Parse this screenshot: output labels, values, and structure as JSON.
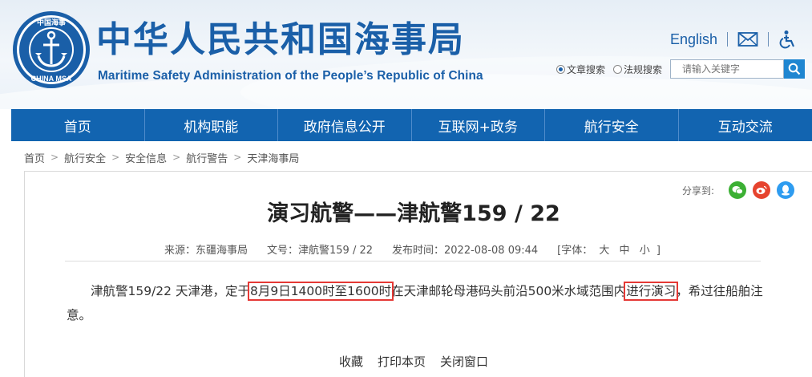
{
  "header": {
    "logo_text_top": "中国海事",
    "logo_text_bottom": "CHINA MSA",
    "site_title": "中华人民共和国海事局",
    "site_subtitle": "Maritime Safety Administration of the People’s Republic of China",
    "english_link": "English",
    "icons": [
      "mail-icon",
      "accessibility-icon"
    ],
    "search": {
      "options": [
        {
          "label": "文章搜索",
          "selected": true
        },
        {
          "label": "法规搜索",
          "selected": false
        }
      ],
      "placeholder": "请输入关键字"
    }
  },
  "nav": {
    "items": [
      "首页",
      "机构职能",
      "政府信息公开",
      "互联网+政务",
      "航行安全",
      "互动交流"
    ]
  },
  "breadcrumb": [
    "首页",
    "航行安全",
    "安全信息",
    "航行警告",
    "天津海事局"
  ],
  "article": {
    "share_label": "分享到:",
    "share_icons": [
      "wechat-icon",
      "weibo-icon",
      "qq-icon"
    ],
    "title": "演习航警——津航警159 / 22",
    "meta": {
      "source": "来源：东疆海事局",
      "doc_no": "文号：津航警159 / 22",
      "publish_time": "发布时间：2022-08-08 09:44",
      "font_label": "[字体：",
      "font_sizes": [
        "大",
        "中",
        "小"
      ],
      "font_close": "]"
    },
    "body": {
      "part1": "津航警159/22  天津港，定于",
      "highlight1": "8月9日1400时至1600时",
      "part2": "在天津邮轮母港码头前沿500米水域范围内",
      "highlight2": "进行演习",
      "part3": "，希过往船舶注意。"
    },
    "actions": [
      "收藏",
      "打印本页",
      "关闭窗口"
    ]
  },
  "colors": {
    "brand_blue": "#1a5fa8",
    "nav_blue": "#1264b0",
    "highlight_red": "#e53935"
  }
}
